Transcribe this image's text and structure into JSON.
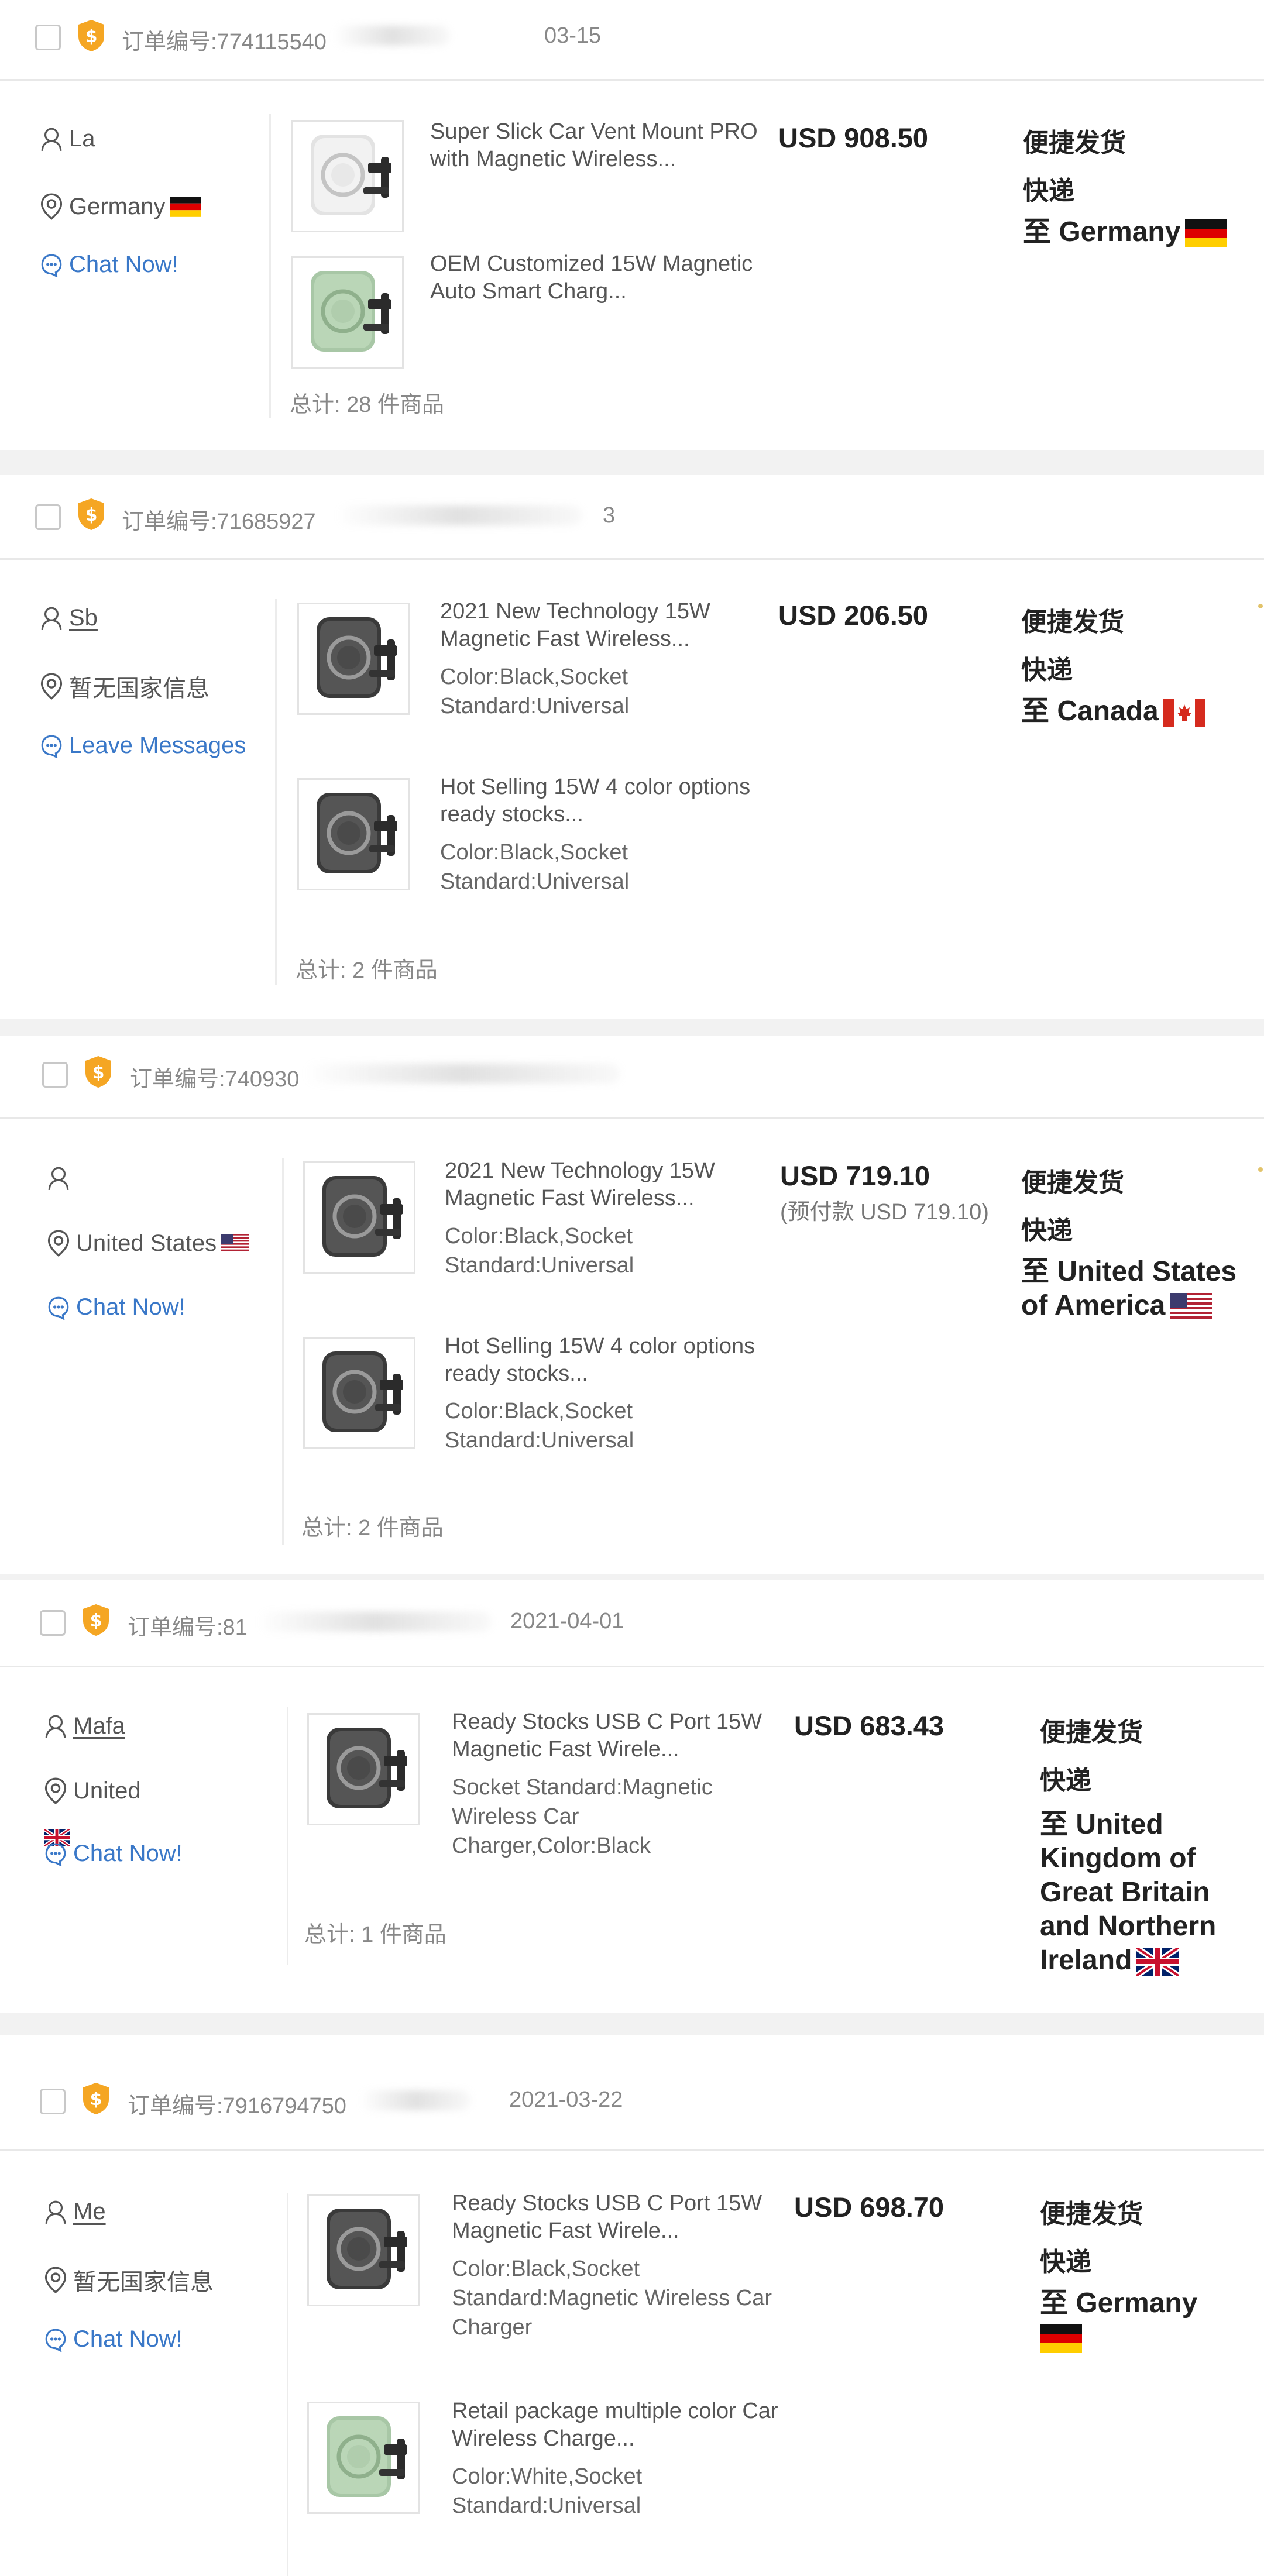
{
  "orders": [
    {
      "order_label": "订单编号:774115540",
      "order_date": "03-15",
      "buyer": {
        "name": "La",
        "country": "Germany",
        "contact": "Chat Now!"
      },
      "items": [
        {
          "title": "Super Slick Car Vent Mount PRO with Magnetic Wireless...",
          "spec": "",
          "color": "white"
        },
        {
          "title": "OEM Customized 15W Magnetic Auto Smart Charg...",
          "spec": "",
          "color": "green"
        }
      ],
      "total": "总计: 28 件商品",
      "price": "USD 908.50",
      "prepay": "",
      "shipping_method": "便捷发货",
      "shipping_type": "快递",
      "destination": "至 Germany",
      "flag": "de"
    },
    {
      "order_label": "订单编号:71685927",
      "order_date": "3",
      "buyer": {
        "name": "Sb",
        "country": "暂无国家信息",
        "contact": "Leave Messages"
      },
      "items": [
        {
          "title": "2021 New Technology 15W Magnetic Fast Wireless...",
          "spec": "Color:Black,Socket Standard:Universal",
          "color": "black"
        },
        {
          "title": "Hot Selling 15W 4 color options ready stocks...",
          "spec": "Color:Black,Socket Standard:Universal",
          "color": "black"
        }
      ],
      "total": "总计: 2 件商品",
      "price": "USD 206.50",
      "prepay": "",
      "shipping_method": "便捷发货",
      "shipping_type": "快递",
      "destination": "至 Canada",
      "flag": "ca"
    },
    {
      "order_label": "订单编号:740930",
      "order_date": "",
      "buyer": {
        "name": "",
        "country": "United States",
        "contact": "Chat Now!"
      },
      "items": [
        {
          "title": "2021 New Technology 15W Magnetic Fast Wireless...",
          "spec": "Color:Black,Socket Standard:Universal",
          "color": "black"
        },
        {
          "title": "Hot Selling 15W 4 color options ready stocks...",
          "spec": "Color:Black,Socket Standard:Universal",
          "color": "black"
        }
      ],
      "total": "总计: 2 件商品",
      "price": "USD 719.10",
      "prepay": "(预付款 USD 719.10)",
      "shipping_method": "便捷发货",
      "shipping_type": "快递",
      "destination": "至 United States of America",
      "flag": "us"
    },
    {
      "order_label": "订单编号:81",
      "order_date": "2021-04-01",
      "buyer": {
        "name": "Mafa",
        "country": "United",
        "contact": "Chat Now!"
      },
      "items": [
        {
          "title": "Ready Stocks USB C Port 15W Magnetic Fast Wirele...",
          "spec": "Socket Standard:Magnetic Wireless Car Charger,Color:Black",
          "color": "black"
        }
      ],
      "total": "总计: 1 件商品",
      "price": "USD 683.43",
      "prepay": "",
      "shipping_method": "便捷发货",
      "shipping_type": "快递",
      "destination": "至 United Kingdom of Great Britain and Northern Ireland",
      "flag": "uk"
    },
    {
      "order_label": "订单编号:7916794750",
      "order_date": "2021-03-22",
      "buyer": {
        "name": "Me",
        "country": "暂无国家信息",
        "contact": "Chat Now!"
      },
      "items": [
        {
          "title": "Ready Stocks USB C Port 15W Magnetic Fast Wirele...",
          "spec": "Color:Black,Socket Standard:Magnetic Wireless Car Charger",
          "color": "black"
        },
        {
          "title": "Retail package multiple color Car Wireless Charge...",
          "spec": "Color:White,Socket Standard:Universal",
          "color": "green"
        }
      ],
      "total": "",
      "price": "USD 698.70",
      "prepay": "",
      "shipping_method": "便捷发货",
      "shipping_type": "快递",
      "destination": "至 Germany",
      "flag": "de"
    }
  ],
  "colors": {
    "page_bg": "#f2f2f2",
    "card_bg": "#ffffff",
    "badge": "#f5a623",
    "chat_link": "#3a78c8",
    "text_main": "#222222",
    "text_muted": "#888888"
  },
  "icons": {
    "badge": "shield-coin-icon",
    "buyer": "user-icon",
    "location": "location-pin-icon",
    "chat": "chat-bubble-icon"
  }
}
